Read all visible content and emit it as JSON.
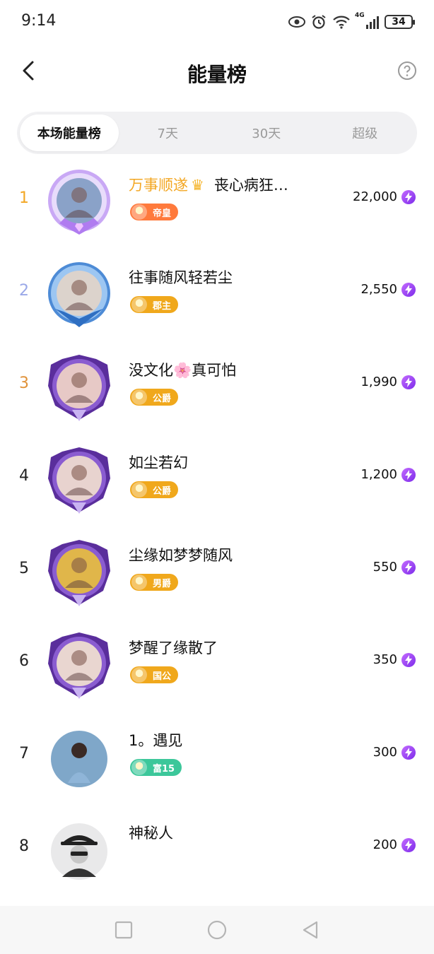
{
  "status": {
    "time": "9:14",
    "network": "4G",
    "battery": "34"
  },
  "header": {
    "title": "能量榜"
  },
  "tabs": [
    "本场能量榜",
    "7天",
    "30天",
    "超级"
  ],
  "rows": [
    {
      "rank": "1",
      "rank_color": "#f3a723",
      "name_tag": "万事顺遂",
      "name": "丧心病狂…",
      "badge": "帝皇",
      "badge_color": "#ff7a3c",
      "score": "22,000",
      "frame": "crown-purple"
    },
    {
      "rank": "2",
      "rank_color": "#9aa8e8",
      "name_tag": "",
      "name": "往事随风轻若尘",
      "badge": "郡主",
      "badge_color": "#f0a81c",
      "score": "2,550",
      "frame": "blue"
    },
    {
      "rank": "3",
      "rank_color": "#e0923a",
      "name_tag": "",
      "name": "没文化🌸真可怕",
      "badge": "公爵",
      "badge_color": "#f0a81c",
      "score": "1,990",
      "frame": "purple"
    },
    {
      "rank": "4",
      "rank_color": "#222222",
      "name_tag": "",
      "name": "如尘若幻",
      "badge": "公爵",
      "badge_color": "#f0a81c",
      "score": "1,200",
      "frame": "purple"
    },
    {
      "rank": "5",
      "rank_color": "#222222",
      "name_tag": "",
      "name": "尘缘如梦梦随风",
      "badge": "男爵",
      "badge_color": "#f0a81c",
      "score": "550",
      "frame": "purple"
    },
    {
      "rank": "6",
      "rank_color": "#222222",
      "name_tag": "",
      "name": "梦醒了缘散了",
      "badge": "国公",
      "badge_color": "#f0a81c",
      "score": "350",
      "frame": "purple"
    },
    {
      "rank": "7",
      "rank_color": "#222222",
      "name_tag": "",
      "name": "1。遇见",
      "badge": "富15",
      "badge_color": "#3cc79a",
      "score": "300",
      "frame": "none"
    },
    {
      "rank": "8",
      "rank_color": "#222222",
      "name_tag": "",
      "name": "神秘人",
      "badge": "",
      "badge_color": "",
      "score": "200",
      "frame": "none"
    }
  ]
}
